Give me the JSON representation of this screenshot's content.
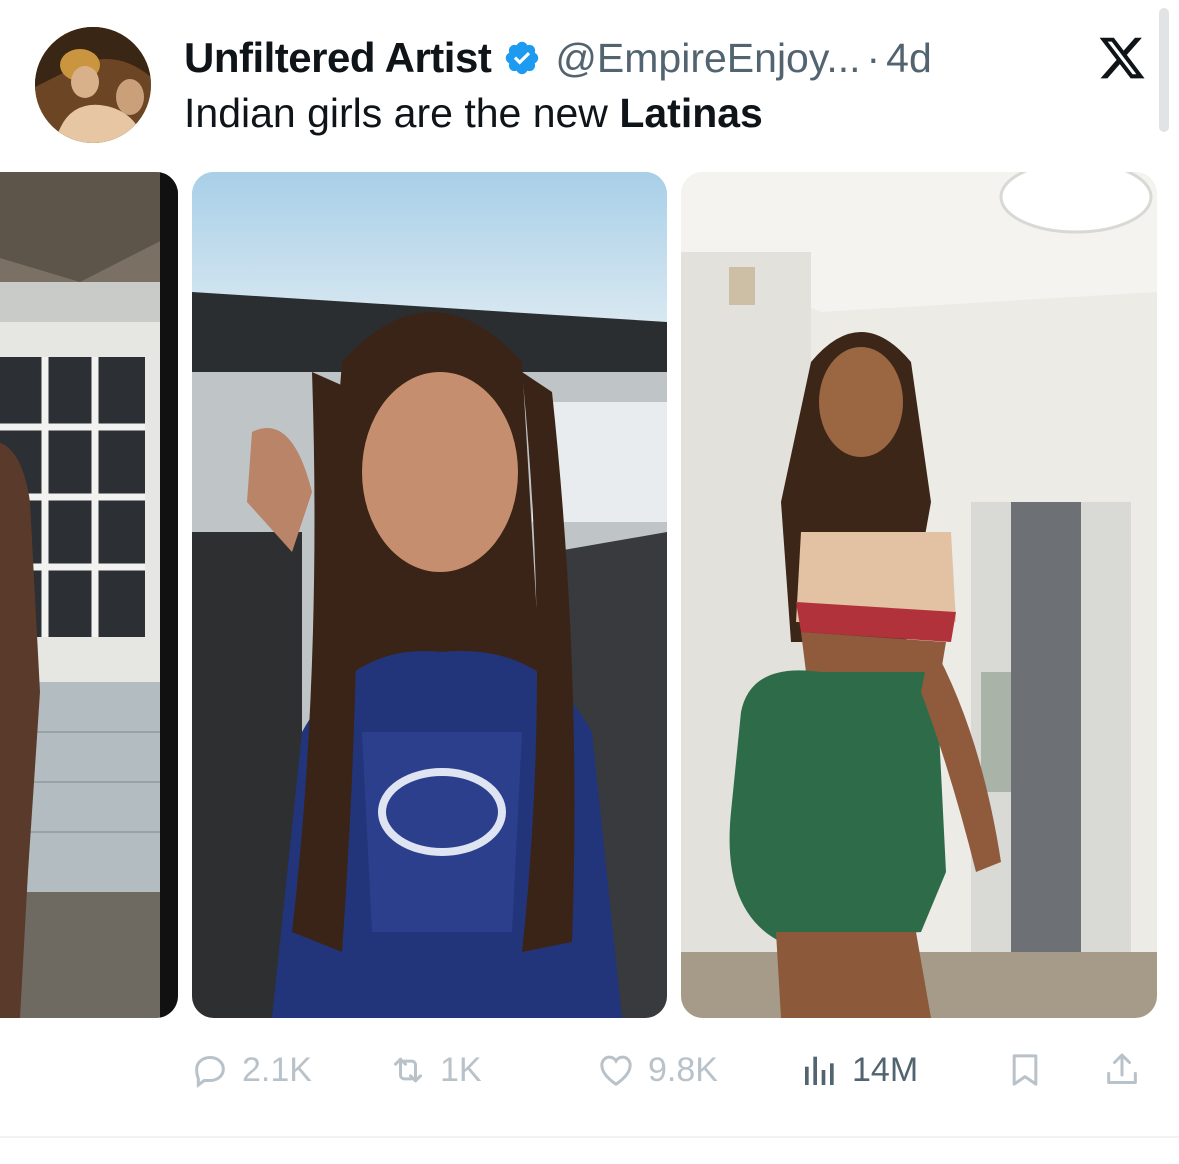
{
  "author": {
    "display_name": "Unfiltered Artist",
    "handle": "@EmpireEnjoy...",
    "separator": "·",
    "time": "4d",
    "verified": true
  },
  "tweet": {
    "text_prefix": "Indian girls are the new ",
    "text_bold": "Latinas"
  },
  "actions": {
    "replies": "2.1K",
    "retweets": "1K",
    "likes": "9.8K",
    "views": "14M"
  },
  "colors": {
    "text_primary": "#0f1419",
    "text_secondary": "#536471",
    "verified_blue": "#1d9bf0",
    "action_muted": "#b9c2c9"
  },
  "icons": [
    "verified-badge-icon",
    "x-logo-icon",
    "reply-icon",
    "retweet-icon",
    "like-icon",
    "views-icon",
    "bookmark-icon",
    "share-icon"
  ]
}
